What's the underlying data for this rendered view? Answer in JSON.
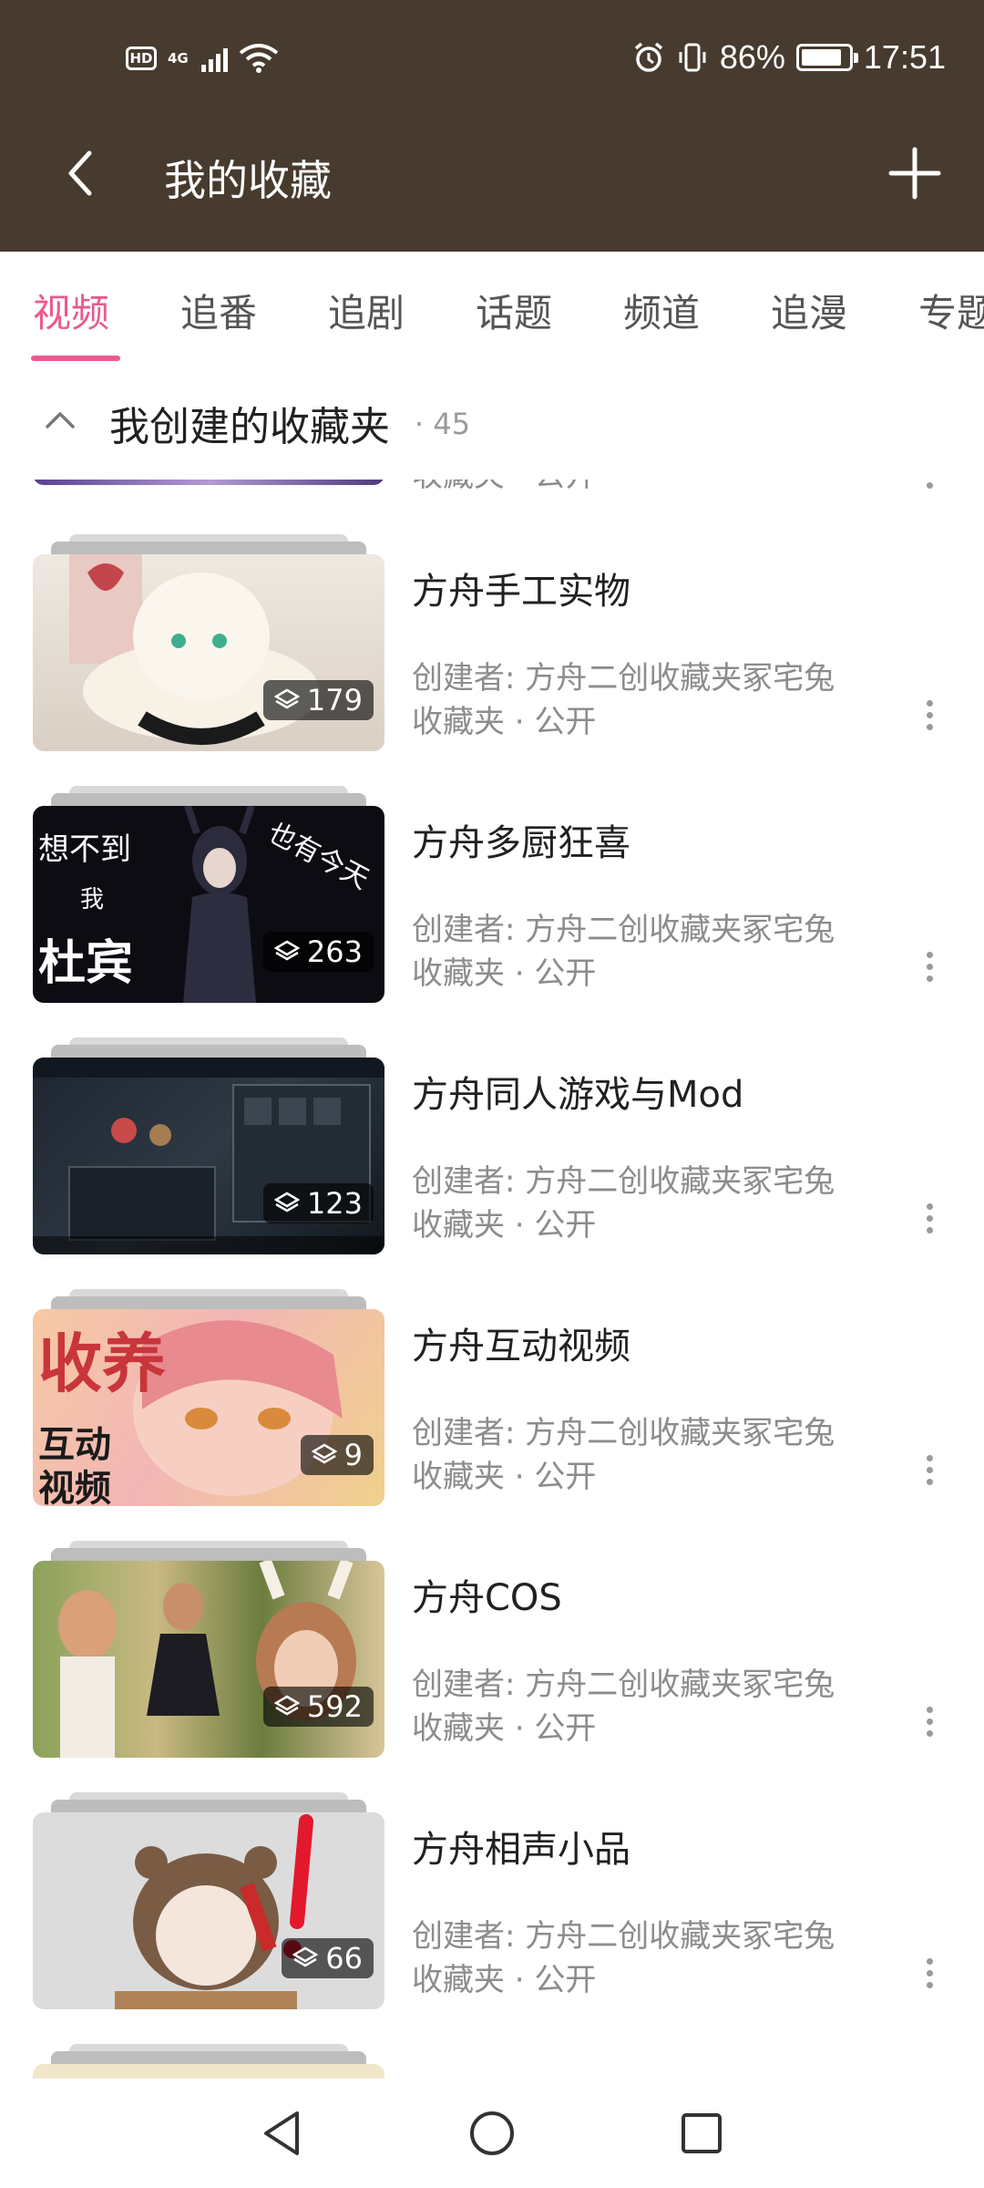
{
  "status_bar": {
    "hd": "HD",
    "network": "4G",
    "battery_percent": "86%",
    "battery_level": 0.86,
    "time": "17:51"
  },
  "title_bar": {
    "back_icon": "chevron-left-icon",
    "title": "我的收藏",
    "add_icon": "plus-icon"
  },
  "tabs": [
    {
      "label": "视频",
      "active": true
    },
    {
      "label": "追番",
      "active": false
    },
    {
      "label": "追剧",
      "active": false
    },
    {
      "label": "话题",
      "active": false
    },
    {
      "label": "频道",
      "active": false
    },
    {
      "label": "追漫",
      "active": false
    },
    {
      "label": "专题",
      "active": false
    }
  ],
  "section": {
    "collapse_icon": "chevron-up-icon",
    "title": "我创建的收藏夹",
    "count": "· 45"
  },
  "partial_top_item": {
    "meta": "收藏夹 · 公开"
  },
  "folders": [
    {
      "title": "方舟手工实物",
      "creator": "创建者: 方舟二创收藏夹冢宅兔",
      "meta": "收藏夹 · 公开",
      "count": "179"
    },
    {
      "title": "方舟多厨狂喜",
      "creator": "创建者: 方舟二创收藏夹冢宅兔",
      "meta": "收藏夹 · 公开",
      "count": "263",
      "thumb_text_1": "想不到",
      "thumb_text_2": "我",
      "thumb_text_3": "杜宾",
      "thumb_text_4": "也有今天"
    },
    {
      "title": "方舟同人游戏与Mod",
      "creator": "创建者: 方舟二创收藏夹冢宅兔",
      "meta": "收藏夹 · 公开",
      "count": "123"
    },
    {
      "title": "方舟互动视频",
      "creator": "创建者: 方舟二创收藏夹冢宅兔",
      "meta": "收藏夹 · 公开",
      "count": "9",
      "thumb_text_1": "收养",
      "thumb_text_2": "互动",
      "thumb_text_3": "视频"
    },
    {
      "title": "方舟COS",
      "creator": "创建者: 方舟二创收藏夹冢宅兔",
      "meta": "收藏夹 · 公开",
      "count": "592"
    },
    {
      "title": "方舟相声小品",
      "creator": "创建者: 方舟二创收藏夹冢宅兔",
      "meta": "收藏夹 · 公开",
      "count": "66"
    }
  ],
  "nav_bar": {
    "back_icon": "triangle-back-icon",
    "home_icon": "circle-home-icon",
    "recents_icon": "square-recents-icon"
  },
  "colors": {
    "header_bg": "#473b2f",
    "accent": "#e95b8f"
  }
}
